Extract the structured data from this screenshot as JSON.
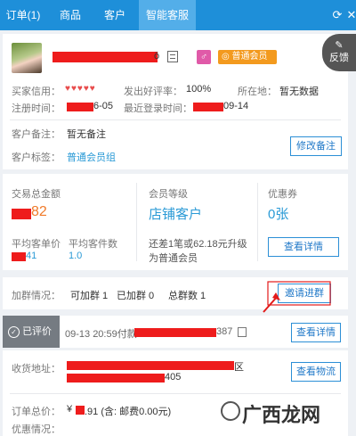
{
  "tabs": [
    {
      "label": "订单(1)",
      "active": false
    },
    {
      "label": "商品",
      "active": false
    },
    {
      "label": "客户",
      "active": false
    },
    {
      "label": "智能客服",
      "active": true
    }
  ],
  "feedback": {
    "icon": "edit-icon",
    "label": "反馈"
  },
  "profile": {
    "name_suffix": "ō",
    "membership": "普通会员",
    "credit_label": "买家信用：",
    "credit_hearts": "♥♥♥♥♥",
    "good_rate_label": "发出好评率：",
    "good_rate": "100%",
    "location_label": "所在地：",
    "location": "暂无数据",
    "reg_label": "注册时间：",
    "reg_suffix": "6-05",
    "last_login_label": "最近登录时间：",
    "last_login_suffix": "09-14",
    "note_label": "客户备注：",
    "note_value": "暂无备注",
    "tag_label": "客户标签：",
    "tag_value": "普通会员组",
    "edit_note_button": "修改备注"
  },
  "stats": {
    "total_label": "交易总金额",
    "total_suffix": "82",
    "level_label": "会员等级",
    "level_value": "店铺客户",
    "coupon_label": "优惠券",
    "coupon_value": "0张",
    "avg_price_label": "平均客单价",
    "avg_price_suffix": "41",
    "avg_count_label": "平均客件数",
    "avg_count": "1.0",
    "upgrade_text_1": "还差1笔或62.18元升级",
    "upgrade_text_2": "为普通会员",
    "view_details_button": "查看详情"
  },
  "group": {
    "label": "加群情况：",
    "can_join": "可加群 1",
    "joined": "已加群 0",
    "total": "总群数 1",
    "invite_button": "邀请进群"
  },
  "order": {
    "status_badge": "已评价",
    "time_text": "09-13 20:59付款",
    "order_id_suffix": "387",
    "view_details_button": "查看详情",
    "address_label": "收货地址：",
    "address_suffix_1": "区",
    "address_suffix_2": "405",
    "view_logistics_button": "查看物流",
    "total_label": "订单总价：",
    "total_prefix": "¥",
    "total_value": ".91 (含: 邮费0.00元)",
    "discount_label": "优惠情况："
  },
  "watermark": {
    "text": "广西龙网"
  },
  "colors": {
    "topbar": "#1e8fd9",
    "accent": "#2a9ad6",
    "member_badge": "#f39a1e",
    "redaction": "#ee1c1c",
    "annotation_arrow": "#e21a1a"
  }
}
